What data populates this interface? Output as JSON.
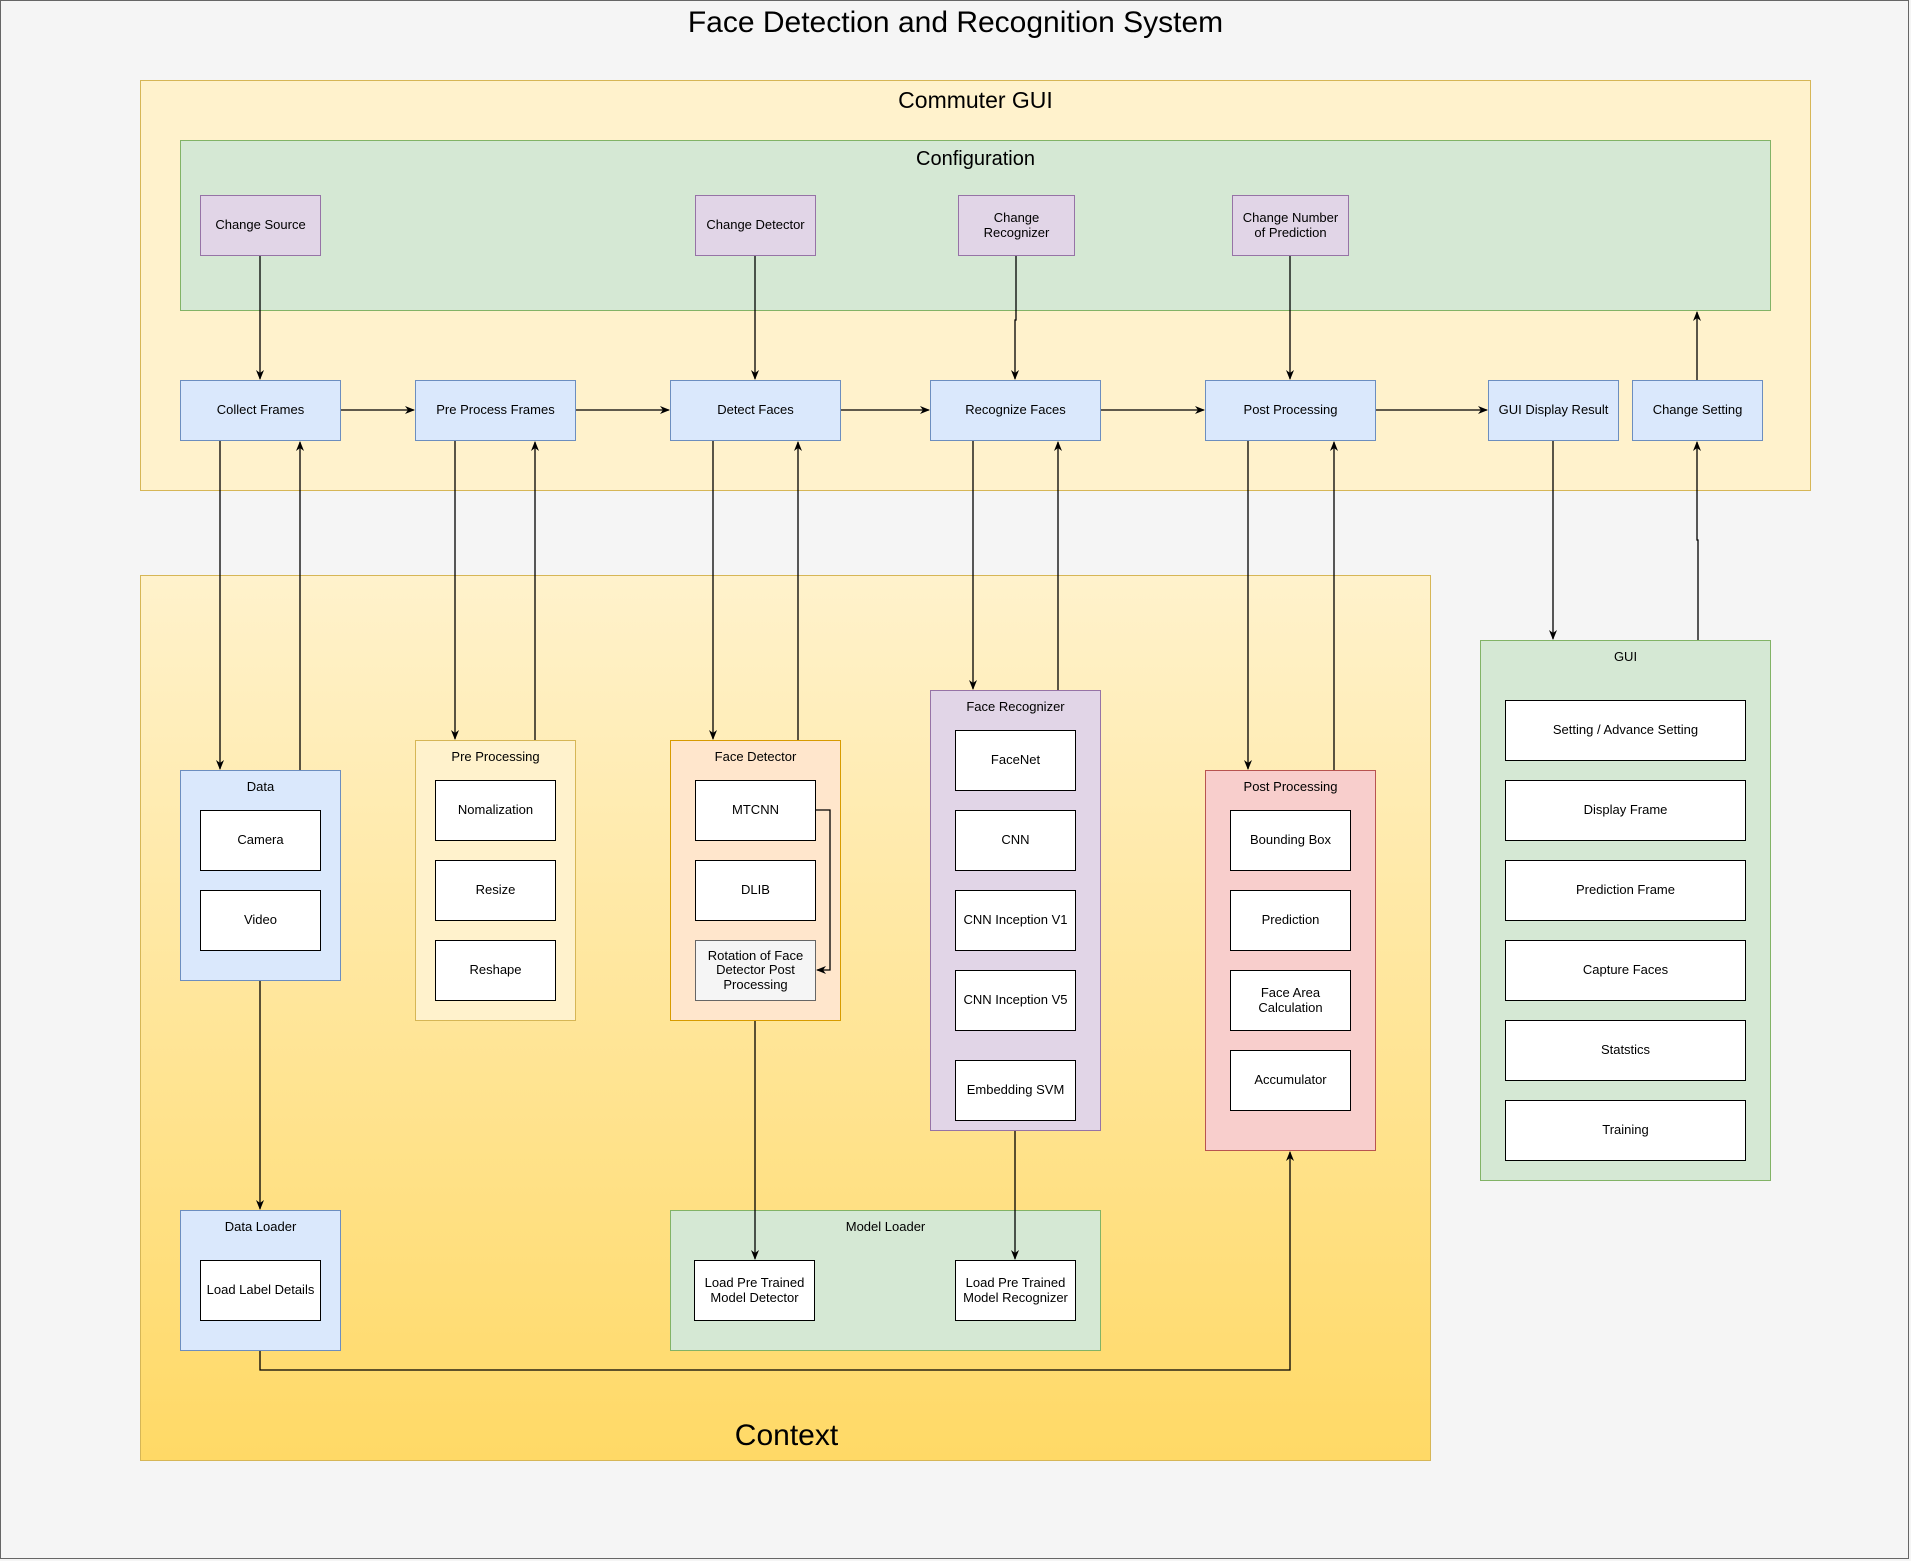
{
  "title": "Face Detection and Recognition System",
  "commuter_gui": {
    "label": "Commuter GUI",
    "configuration": {
      "label": "Configuration",
      "items": [
        "Change Source",
        "Change Detector",
        "Change Recognizer",
        "Change Number of Prediction"
      ]
    },
    "pipeline": [
      "Collect Frames",
      "Pre Process Frames",
      "Detect Faces",
      "Recognize Faces",
      "Post Processing",
      "GUI Display Result",
      "Change Setting"
    ]
  },
  "context": {
    "label": "Context",
    "data": {
      "title": "Data",
      "items": [
        "Camera",
        "Video"
      ]
    },
    "pre_processing": {
      "title": "Pre Processing",
      "items": [
        "Nomalization",
        "Resize",
        "Reshape"
      ]
    },
    "face_detector": {
      "title": "Face Detector",
      "items": [
        "MTCNN",
        "DLIB",
        "Rotation of Face Detector Post Processing"
      ]
    },
    "face_recognizer": {
      "title": "Face Recognizer",
      "items": [
        "FaceNet",
        "CNN",
        "CNN Inception V1",
        "CNN Inception V5",
        "Embedding SVM"
      ]
    },
    "post_processing": {
      "title": "Post Processing",
      "items": [
        "Bounding Box",
        "Prediction",
        "Face Area Calculation",
        "Accumulator"
      ]
    },
    "data_loader": {
      "title": "Data Loader",
      "items": [
        "Load Label Details"
      ]
    },
    "model_loader": {
      "title": "Model Loader",
      "items": [
        "Load Pre Trained Model Detector",
        "Load Pre Trained Model Recognizer"
      ]
    }
  },
  "gui": {
    "title": "GUI",
    "items": [
      "Setting / Advance Setting",
      "Display Frame",
      "Prediction Frame",
      "Capture Faces",
      "Statstics",
      "Training"
    ]
  },
  "colors": {
    "background": "#f5f5f5",
    "commuter_fill": "#fff2cc",
    "configuration_fill": "#d5e8d4",
    "context_gradient_top": "#fff2cc",
    "context_gradient_bottom": "#ffd966",
    "config_item_fill": "#e1d5e7",
    "pipeline_fill": "#dae8fc"
  }
}
